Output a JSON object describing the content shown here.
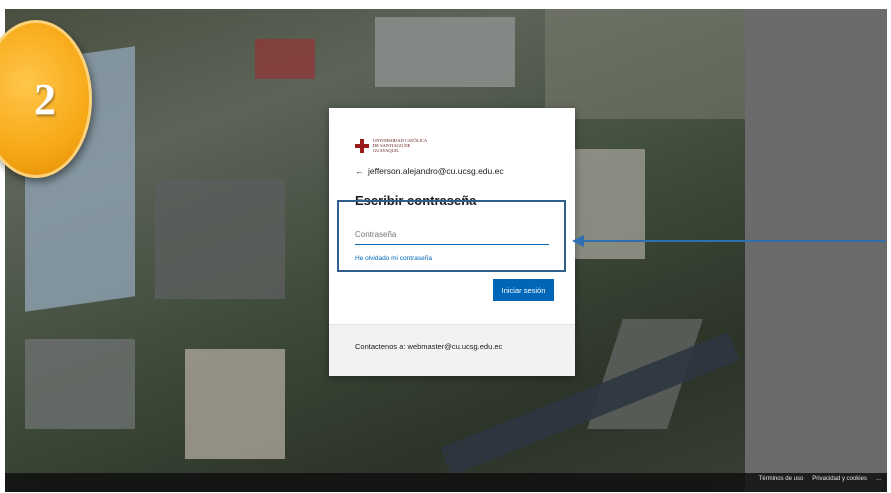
{
  "step": {
    "number": "2"
  },
  "login_card": {
    "logo_text": "UNIVERSIDAD CATÓLICA DE SANTIAGO DE GUAYAQUIL",
    "back_arrow": "←",
    "account_email": "jefferson.alejandro@cu.ucsg.edu.ec",
    "title": "Escribir contraseña",
    "password_field": {
      "placeholder": "Contraseña",
      "value": ""
    },
    "forgot_password_link": "He olvidado mi contraseña",
    "signin_button": "Iniciar sesión",
    "contact_text": "Contactenos a: webmaster@cu.ucsg.edu.ec"
  },
  "footer": {
    "terms": "Términos de uso",
    "privacy": "Privacidad y cookies",
    "more": "..."
  },
  "colors": {
    "accent": "#0067b8",
    "annotation": "#2f6fb0",
    "badge": "#f7a917"
  }
}
